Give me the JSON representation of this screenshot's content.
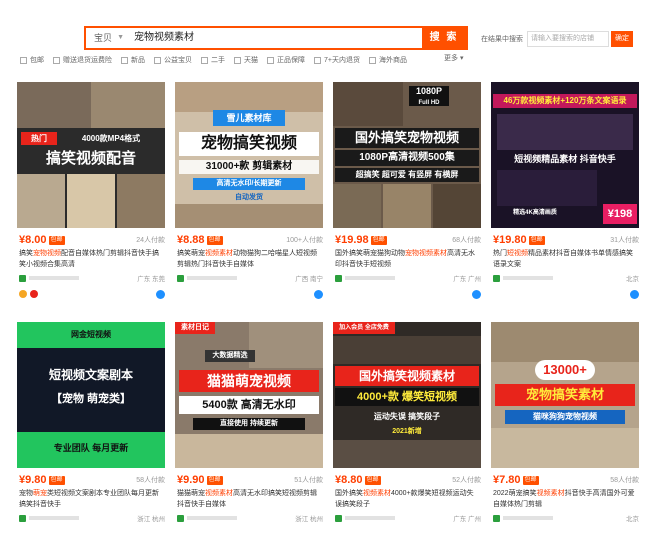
{
  "search": {
    "scope": "宝贝",
    "query": "宠物视频素材",
    "button": "搜 索"
  },
  "shop_search": {
    "label": "在结果中搜索",
    "placeholder": "请输入要搜索的店铺",
    "button": "确定"
  },
  "filters": [
    "包邮",
    "赠送退货运费险",
    "新品",
    "公益宝贝",
    "二手",
    "天猫",
    "正品保障",
    "7+天内退货",
    "海外商品"
  ],
  "more_label": "更多",
  "colors": {
    "accent": "#ff5000",
    "price": "#ff3e00"
  },
  "products": [
    {
      "price": "¥8.00",
      "badge": "包邮",
      "sales": "24人付款",
      "title_pre": "搞笑",
      "title_hl": "宠物视频",
      "title_post": "配音自媒体热门剪辑抖音快手搞笑小视频合集高清",
      "location": "广东 东莞",
      "overlay_lines": [
        "热门",
        "4000款MP4格式",
        "搞笑视频配音"
      ]
    },
    {
      "price": "¥8.88",
      "badge": "包邮",
      "sales": "100+人付款",
      "title_pre": "搞笑萌宠",
      "title_hl": "视频素材",
      "title_post": "动物猫狗二哈喵星人短视频剪辑热门抖音快手自媒体",
      "location": "广西 南宁",
      "overlay_lines": [
        "雪儿素材库",
        "宠物搞笑视频",
        "31000+款 剪辑素材",
        "高清无水印/长期更新",
        "自动发货"
      ]
    },
    {
      "price": "¥19.98",
      "badge": "包邮",
      "sales": "68人付款",
      "title_pre": "国外搞笑萌宠猫狗动物",
      "title_hl": "宠物视频素材",
      "title_post": "高清无水印抖音快手短视频",
      "location": "广东 广州",
      "overlay_lines": [
        "1080P",
        "Full HD",
        "国外搞笑宠物视频",
        "1080P高清视频500集",
        "超搞笑 超可爱 有竖屏 有横屏"
      ]
    },
    {
      "price": "¥19.80",
      "badge": "包邮",
      "sales": "31人付款",
      "title_pre": "热门",
      "title_hl": "短视频",
      "title_post": "精品素材抖音自媒体书单情感搞笑语录文案",
      "location": "北京",
      "overlay_lines": [
        "46万款视频素材+120万条文案语录",
        "短视频精品素材 抖音快手",
        "精选4K高清画质",
        "¥198"
      ]
    },
    {
      "price": "¥9.80",
      "badge": "包邮",
      "sales": "58人付款",
      "title_pre": "宠物",
      "title_hl": "萌宠",
      "title_post": "类短视频文案剧本专业团队每月更新搞笑抖音快手",
      "location": "浙江 杭州",
      "overlay_lines": [
        "网金短视频",
        "短视频文案剧本",
        "【宠物 萌宠类】",
        "专业团队 每月更新"
      ]
    },
    {
      "price": "¥9.90",
      "badge": "包邮",
      "sales": "51人付款",
      "title_pre": "猫猫萌宠",
      "title_hl": "视频素材",
      "title_post": "高清无水印搞笑短视频剪辑抖音快手自媒体",
      "location": "浙江 杭州",
      "overlay_lines": [
        "素材日记",
        "大数据精选",
        "猫猫萌宠视频",
        "5400款 高清无水印",
        "直接使用 持续更新"
      ]
    },
    {
      "price": "¥8.80",
      "badge": "包邮",
      "sales": "52人付款",
      "title_pre": "国外搞笑",
      "title_hl": "视频素材",
      "title_post": "4000+款爆笑短视频运动失误搞笑段子",
      "location": "广东 广州",
      "overlay_lines": [
        "加入会员 全店免费",
        "国外搞笑视频素材",
        "4000+款 爆笑短视频",
        "运动失误 搞笑段子",
        "2021新增"
      ]
    },
    {
      "price": "¥7.80",
      "badge": "包邮",
      "sales": "58人付款",
      "title_pre": "2022萌宠搞笑",
      "title_hl": "视频素材",
      "title_post": "抖音快手高清国外可爱自媒体热门剪辑",
      "location": "北京",
      "overlay_lines": [
        "13000+",
        "宠物搞笑素材",
        "猫咪狗狗宠物视频"
      ]
    }
  ]
}
